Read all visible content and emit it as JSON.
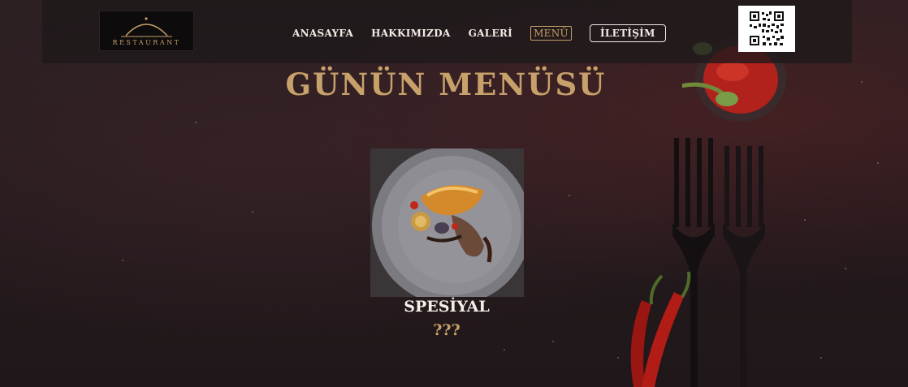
{
  "header": {
    "logo_text": "RESTAURANT",
    "nav": [
      {
        "label": "ANASAYFA"
      },
      {
        "label": "HAKKIMIZDA"
      },
      {
        "label": "GALERİ"
      },
      {
        "label": "MENÜ",
        "active": true
      },
      {
        "label": "İLETİŞİM"
      }
    ],
    "qr_icon": "qr-code-icon"
  },
  "main": {
    "title": "GÜNÜN MENÜSÜ",
    "dish": {
      "name": "SPESİYAL",
      "price": "???"
    }
  },
  "colors": {
    "accent": "#c7a06a",
    "text_light": "#f5efe8",
    "background": "#241a1d"
  }
}
